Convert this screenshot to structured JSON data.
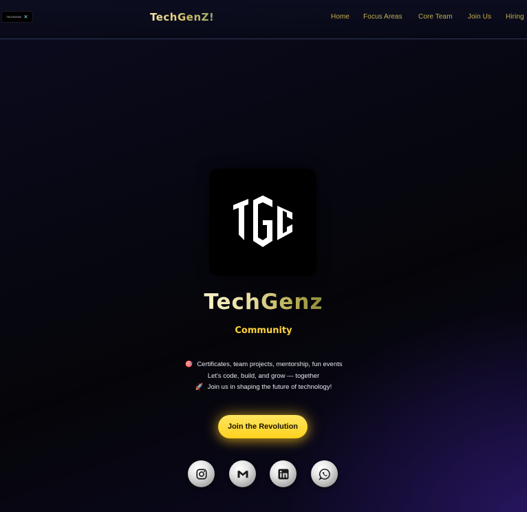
{
  "header": {
    "mini_logo_text": "TECHGENZ",
    "brand": "TechGenZ!",
    "nav": [
      "Home",
      "Focus Areas",
      "Core Team",
      "Join Us",
      "Hiring"
    ]
  },
  "hero": {
    "title": "TechGenz",
    "subtitle": "Community",
    "lines": [
      {
        "emoji": "🎯",
        "text": "Certificates, team projects, mentorship, fun events"
      },
      {
        "emoji": "",
        "text": "Let's code, build, and grow — together"
      },
      {
        "emoji": "🚀",
        "text": "Join us in shaping the future of technology!"
      }
    ],
    "cta": "Join the Revolution"
  },
  "socials": [
    "instagram-icon",
    "gmail-icon",
    "linkedin-icon",
    "whatsapp-icon"
  ],
  "colors": {
    "accent": "#ffd23a",
    "nav": "#c7b24b",
    "background": "#070712"
  }
}
